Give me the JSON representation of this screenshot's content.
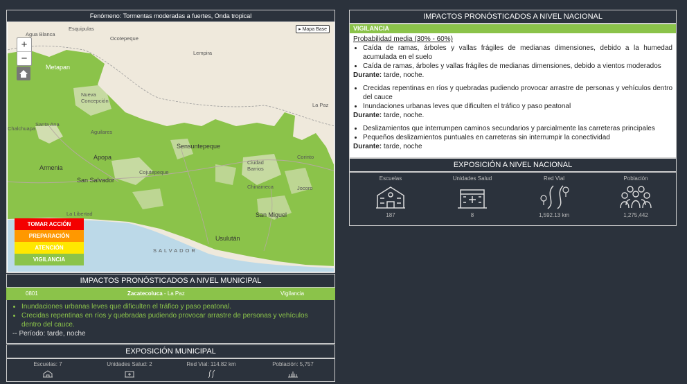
{
  "map": {
    "title": "Fenómeno: Tormentas moderadas a fuertes, Onda tropical",
    "basemap_button": "Mapa Base",
    "zoom_in": "+",
    "zoom_out": "−",
    "labels": [
      "Agua Blanca",
      "Esquipulas",
      "Ocotepeque",
      "Metapan",
      "Nueva Concepción",
      "Santa Ana",
      "Chalchuapa",
      "Aguilares",
      "Apopa",
      "Armenia",
      "San Salvador",
      "Cojutepeque",
      "Sensuntepeque",
      "La Libertad",
      "San Miguel",
      "Usulután",
      "Chinameca",
      "Corinto",
      "Jocoro",
      "Ciudad Barrios",
      "Lempira",
      "La Paz",
      "SALVADOR"
    ],
    "legend": [
      {
        "label": "TOMAR ACCIÓN",
        "color": "#f40000"
      },
      {
        "label": "PREPARACIÓN",
        "color": "#ff9800"
      },
      {
        "label": "ATENCIÓN",
        "color": "#ffe800"
      },
      {
        "label": "VIGILANCIA",
        "color": "#8bc34a"
      }
    ]
  },
  "municipal": {
    "title": "IMPACTOS PRONÓSTICADOS A NIVEL MUNICIPAL",
    "code": "0801",
    "name": "Zacatecoluca",
    "dept": " - La Paz",
    "level": "Vigilancia",
    "impacts": [
      "Inundaciones urbanas leves que dificulten el tráfico y paso peatonal.",
      "Crecidas repentinas en ríos y quebradas pudiendo provocar arrastre de personas y vehículos dentro del cauce."
    ],
    "period": "-- Período: tarde, noche",
    "exposure_title": "EXPOSICIÓN MUNICIPAL",
    "exposure": {
      "schools": "Escuelas: 7",
      "health": "Unidades Salud: 2",
      "roads": "Red Vial: 114.82 km",
      "population": "Población: 5,757"
    }
  },
  "national": {
    "title": "IMPACTOS PRONÓSTICADOS A NIVEL NACIONAL",
    "level": "VIGILANCIA",
    "probability": "Probabilidad media (30% - 60%)",
    "groups": [
      {
        "items": [
          "Caída de ramas, árboles y vallas frágiles de medianas dimensiones, debido a la humedad acumulada en el suelo",
          "Caída de ramas, árboles y vallas frágiles de medianas dimensiones, debido a vientos moderados"
        ],
        "duration_label": "Durante:",
        "duration": " tarde, noche."
      },
      {
        "items": [
          "Crecidas repentinas en ríos y quebradas pudiendo provocar arrastre de personas y vehículos dentro del cauce",
          "Inundaciones urbanas leves que dificulten el tráfico y paso peatonal"
        ],
        "duration_label": "Durante:",
        "duration": " tarde, noche."
      },
      {
        "items": [
          "Deslizamientos que interrumpen caminos secundarios y parcialmente las carreteras principales",
          "Pequeños deslizamientos puntuales en carreteras sin interrumpir la conectividad"
        ],
        "duration_label": "Durante:",
        "duration": " tarde, noche"
      }
    ],
    "exposure_title": "EXPOSICIÓN A NIVEL NACIONAL",
    "exposure": [
      {
        "label": "Escuelas",
        "value": "187",
        "icon": "school-icon"
      },
      {
        "label": "Unidades Salud",
        "value": "8",
        "icon": "hospital-icon"
      },
      {
        "label": "Red Vial",
        "value": "1,592.13 km",
        "icon": "road-icon"
      },
      {
        "label": "Población",
        "value": "1,275,442",
        "icon": "population-icon"
      }
    ]
  }
}
